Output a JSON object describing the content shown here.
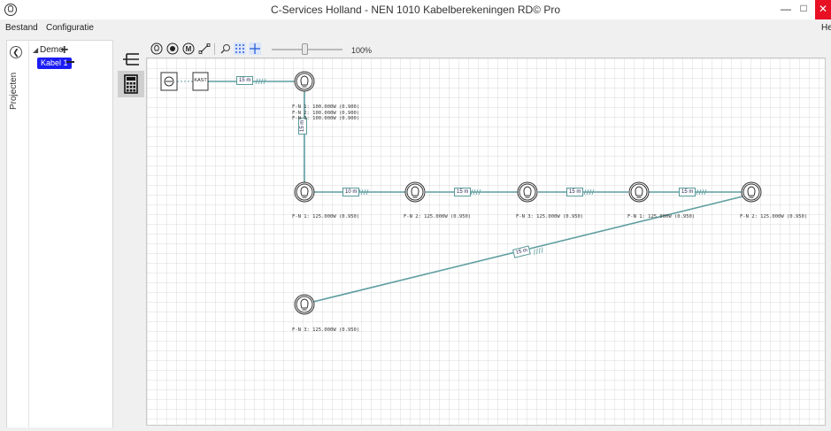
{
  "window": {
    "title": "C-Services Holland - NEN 1010 Kabelberekeningen RD©  Pro",
    "minimize": "—",
    "maximize": "□",
    "close": "✕"
  },
  "menu": {
    "items": [
      "Bestand",
      "Configuratie"
    ],
    "help": "Help"
  },
  "sidebar": {
    "label": "Projecten",
    "tree": {
      "project": "Demo",
      "cable": "Kabel 1"
    }
  },
  "toolbar": {
    "icons": [
      "lamp-icon",
      "record-icon",
      "motor-icon",
      "cable-tool-icon",
      "zoom-icon",
      "grid-icon",
      "crosshair-icon"
    ],
    "zoom": "100%"
  },
  "diagram": {
    "source": "KAST",
    "cables": [
      "15 m",
      "15 m",
      "10 m",
      "15 m",
      "15 m",
      "15 m",
      "15 m"
    ],
    "top_load_lines": [
      "F-N 1: 100.000W (0.900)",
      "F-N 2: 100.000W (0.900)",
      "F-N 3: 100.000W (0.900)"
    ],
    "loads": [
      "F-N 1: 125.000W (0.950)",
      "F-N 2: 125.000W (0.950)",
      "F-N 3: 125.000W (0.950)",
      "F-N 1: 125.000W (0.950)",
      "F-N 2: 125.000W (0.950)",
      "F-N 3: 125.000W (0.950)"
    ]
  },
  "colors": {
    "cable": "#5f9ea0",
    "selection": "#1c1cf5",
    "close_button": "#e81123"
  }
}
